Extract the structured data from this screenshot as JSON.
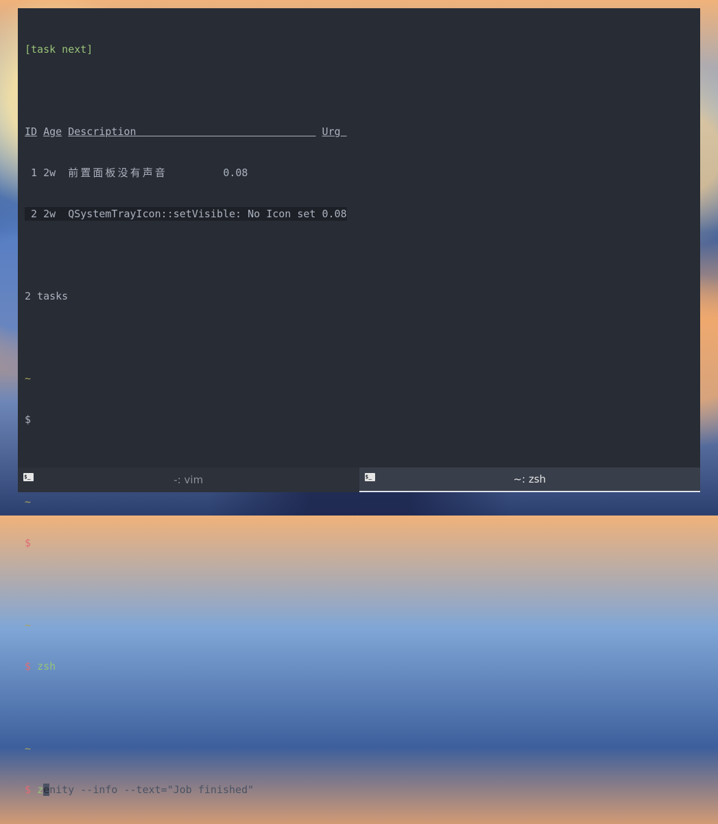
{
  "terminal": {
    "prompt_cmd": "[task next]",
    "table": {
      "headers": [
        "ID",
        "Age",
        "Description",
        "Urg"
      ],
      "rows": [
        {
          "id": "1",
          "age": "2w",
          "desc": "前置面板没有声音",
          "urg": "0.08"
        },
        {
          "id": "2",
          "age": "2w",
          "desc": "QSystemTrayIcon::setVisible: No Icon set",
          "urg": "0.08"
        }
      ]
    },
    "summary": "2 tasks",
    "tilde": "~",
    "dollar": "$",
    "cmd_zsh": "zsh",
    "typed": "z",
    "cursor_char": "e",
    "suggestion": "nity --info --text=\"Job finished\""
  },
  "tabs": [
    {
      "label": "-: vim",
      "icon": "terminal-icon",
      "icon_text": "$_",
      "active": false
    },
    {
      "label": "~: zsh",
      "icon": "terminal-icon",
      "icon_text": "$_",
      "active": true
    }
  ],
  "colors": {
    "background": "#282c34",
    "green": "#98c379",
    "red": "#e06c75",
    "tilde": "#a6a35a",
    "ghost": "#4b5263"
  }
}
